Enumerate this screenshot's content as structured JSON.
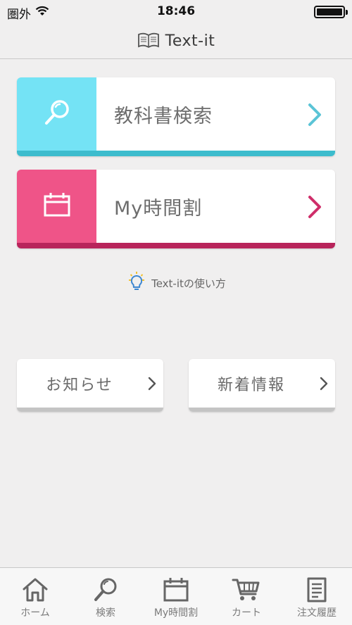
{
  "status_bar": {
    "carrier": "圏外",
    "time": "18:46"
  },
  "nav": {
    "title": "Text-it",
    "icon": "book-icon"
  },
  "cards": {
    "search": {
      "label": "教科書検索",
      "icon": "search-icon",
      "accent": "#74e3f5",
      "accent_dark": "#3dbccd"
    },
    "timetable": {
      "label": "My時間割",
      "icon": "calendar-icon",
      "accent": "#ef5488",
      "accent_dark": "#b8245b"
    }
  },
  "howto": {
    "label": "Text-itの使い方",
    "icon": "lightbulb-icon"
  },
  "small_cards": {
    "news": {
      "label": "お知らせ"
    },
    "new_arrivals": {
      "label": "新着情報"
    }
  },
  "tab_bar": {
    "items": [
      {
        "label": "ホーム",
        "icon": "home-icon"
      },
      {
        "label": "検索",
        "icon": "search-icon"
      },
      {
        "label": "My時間割",
        "icon": "calendar-icon"
      },
      {
        "label": "カート",
        "icon": "cart-icon"
      },
      {
        "label": "注文履歴",
        "icon": "document-icon"
      }
    ]
  }
}
